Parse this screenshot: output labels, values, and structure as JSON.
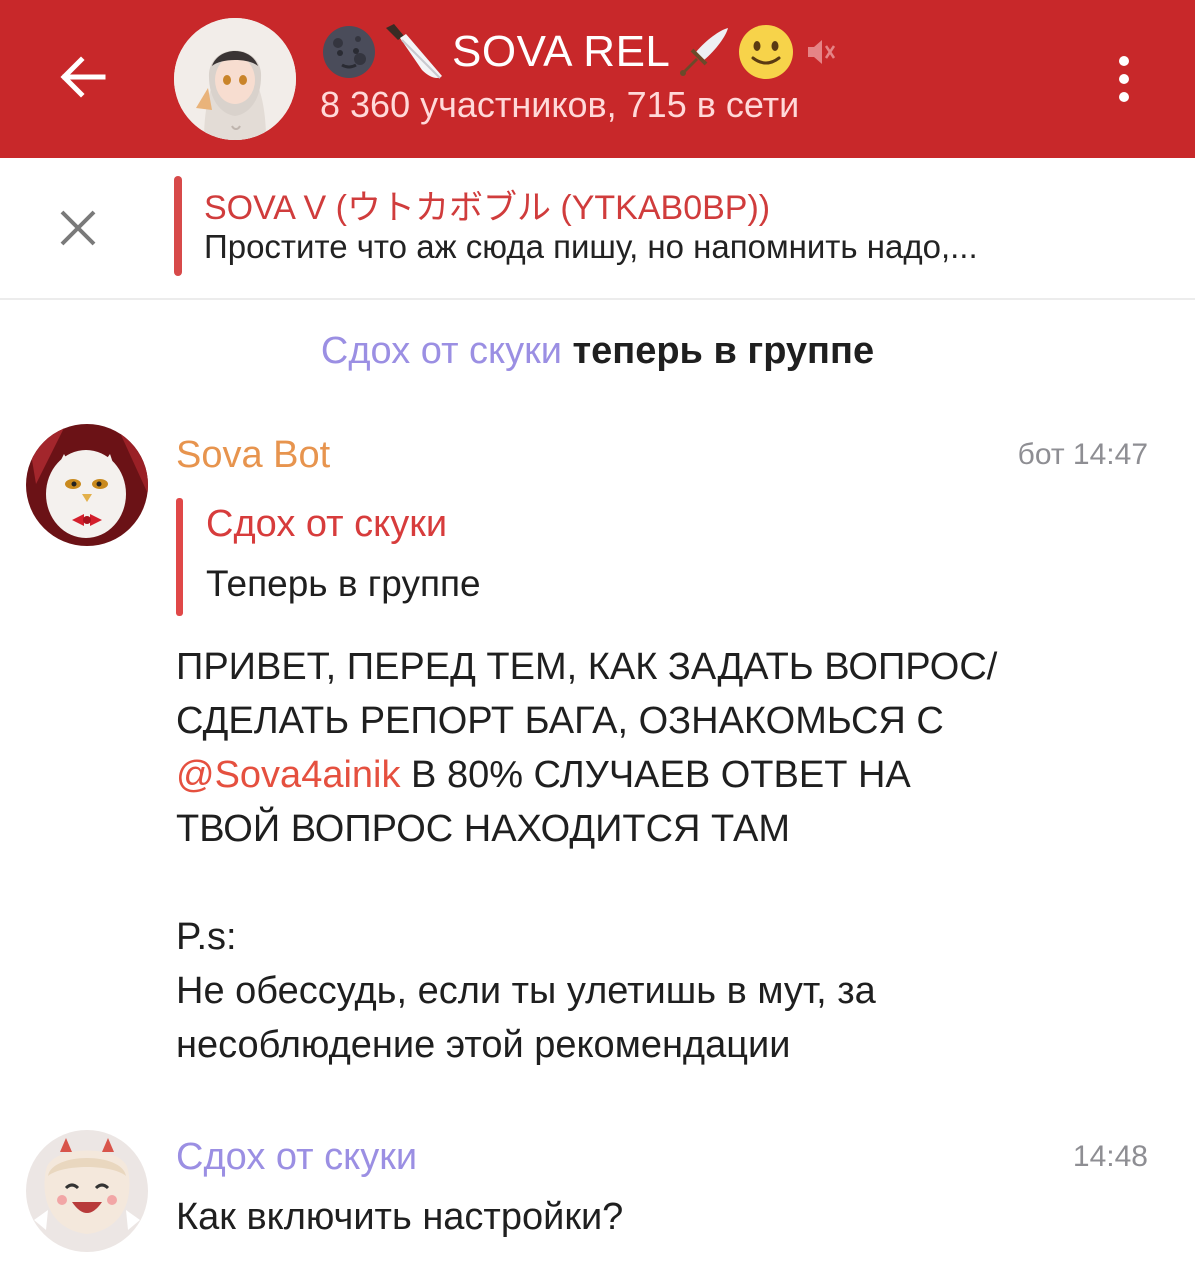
{
  "header": {
    "title": "SOVA REL",
    "subtitle": "8 360 участников, 715 в сети",
    "colors": {
      "background": "#c8282a"
    },
    "icons": [
      "back-arrow-icon",
      "new-moon-face-emoji",
      "knife-emoji",
      "dagger-emoji",
      "slightly-smiling-face-emoji",
      "muted-icon",
      "more-vertical-icon"
    ]
  },
  "pinned": {
    "title": "SOVA V (ウトカボブル (YTKAB0BP))",
    "text": "Простите что аж сюда пишу, но напомнить надо,..."
  },
  "service_message": {
    "joiner": "Сдох от скуки",
    "action": "теперь в группе"
  },
  "messages": [
    {
      "sender": "Sova Bot",
      "time": "бот 14:47",
      "reply": {
        "name": "Сдох от скуки",
        "text": "Теперь в группе"
      },
      "body": {
        "line1": "ПРИВЕТ, ПЕРЕД ТЕМ, КАК ЗАДАТЬ ВОПРОС/",
        "line2": "СДЕЛАТЬ РЕПОРТ БАГА, ОЗНАКОМЬСЯ  С",
        "mention": "@Sova4ainik",
        "line3_rest": " В 80% СЛУЧАЕВ ОТВЕТ НА",
        "line4": "ТВОЙ ВОПРОС НАХОДИТСЯ ТАМ",
        "ps": "P.s:",
        "line5": "Не обессудь, если ты улетишь в мут, за",
        "line6": "несоблюдение этой рекомендации"
      }
    },
    {
      "sender": "Сдох от скуки",
      "time": "14:48",
      "text": "Как включить настройки?"
    }
  ]
}
